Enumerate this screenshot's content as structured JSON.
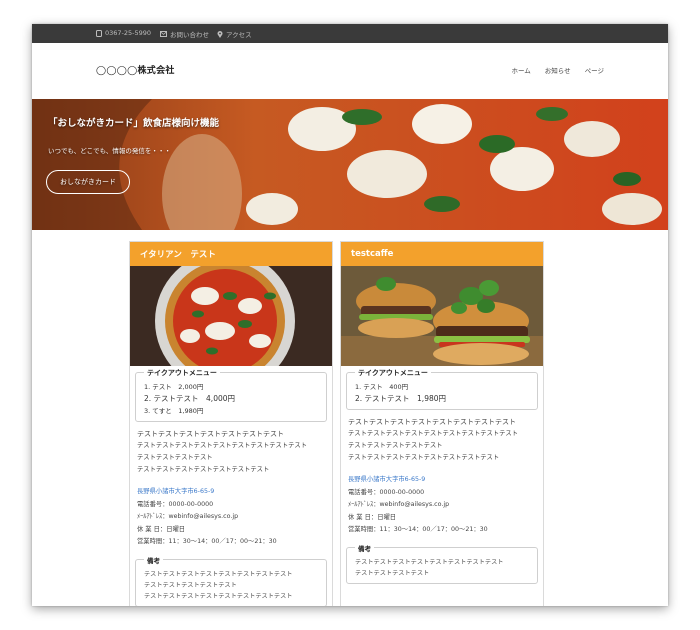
{
  "topbar": {
    "phone": "0367-25-5990",
    "contact": "お問い合わせ",
    "access": "アクセス"
  },
  "header": {
    "logo": "◯◯◯◯株式会社",
    "nav": [
      "ホーム",
      "お知らせ",
      "ページ"
    ]
  },
  "hero": {
    "title": "「おしながきカード」飲食店様向け機能",
    "subtitle": "いつでも、どこでも、情報の発信を・・・",
    "button": "おしながきカード"
  },
  "cards": [
    {
      "title": "イタリアン　テスト",
      "menu_title": "テイクアウトメニュー",
      "menu": [
        "1. テスト　2,000円",
        "2. テストテスト　4,000円",
        "3. てすと　1,980円"
      ],
      "desc": [
        "テストテストテストテストテストテストテスト",
        "テストテストテストテストテストテストテストテストテスト",
        "テストテストテストテスト",
        "テストテストテストテストテストテストテスト"
      ],
      "address": "長野県小諸市大字市6-65-9",
      "phone": "電話番号：0000-00-0000",
      "mail": "ﾒｰﾙｱﾄﾞﾚｽ：webinfo@ailesys.co.jp",
      "holiday": "休 業 日：日曜日",
      "hours": "営業時間：11：30～14：00／17：00～21：30",
      "remark_title": "備考",
      "remarks": [
        "テストテストテストテストテストテストテストテスト",
        "テストテストテストテストテスト",
        "テストテストテストテストテストテストテストテスト"
      ]
    },
    {
      "title": "testcaffe",
      "menu_title": "テイクアウトメニュー",
      "menu": [
        "1. テスト　400円",
        "2. テストテスト　1,980円"
      ],
      "desc": [
        "テストテストテストテストテストテストテストテスト",
        "テストテストテストテストテストテストテストテストテスト",
        "テストテストテストテストテスト",
        "テストテストテストテストテストテストテストテスト"
      ],
      "address": "長野県小諸市大字市6-65-9",
      "phone": "電話番号：0000-00-0000",
      "mail": "ﾒｰﾙｱﾄﾞﾚｽ：webinfo@ailesys.co.jp",
      "holiday": "休 業 日：日曜日",
      "hours": "営業時間：11：30～14：00／17：00～21：30",
      "remark_title": "備考",
      "remarks": [
        "テストテストテストテストテストテストテストテスト",
        "テストテストテストテスト"
      ]
    }
  ],
  "colors": {
    "topbar": "#3a3a3a",
    "accent": "#f3a12c",
    "link": "#3a78c9"
  }
}
